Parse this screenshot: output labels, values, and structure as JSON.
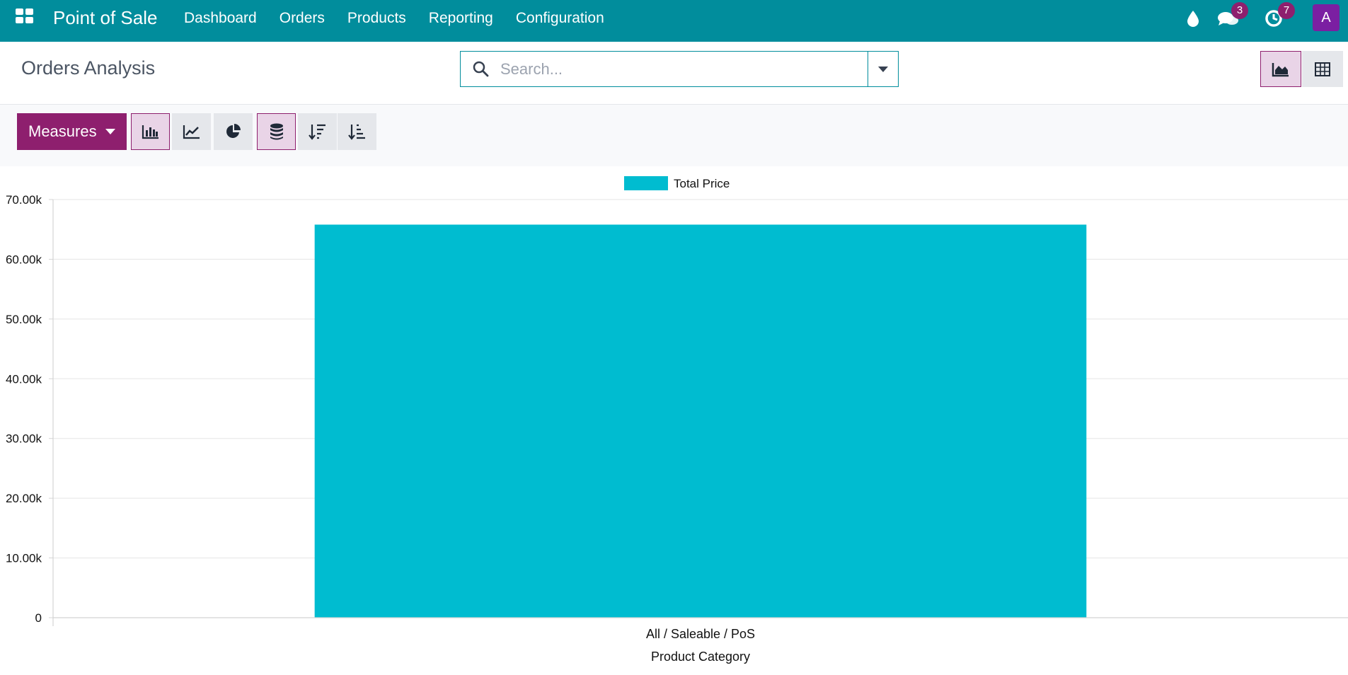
{
  "navbar": {
    "apps_icon": "grid-icon",
    "brand": "Point of Sale",
    "menu": [
      {
        "label": "Dashboard"
      },
      {
        "label": "Orders"
      },
      {
        "label": "Products"
      },
      {
        "label": "Reporting"
      },
      {
        "label": "Configuration"
      }
    ],
    "systray": {
      "debug_icon": "droplet-icon",
      "messages_icon": "chat-bubbles-icon",
      "messages_count": "3",
      "activities_icon": "clock-icon",
      "activities_count": "7",
      "avatar_letter": "A"
    },
    "color": "#018d9c"
  },
  "control_panel": {
    "title": "Orders Analysis",
    "search": {
      "placeholder": "Search...",
      "value": ""
    },
    "views": [
      {
        "name": "graph",
        "icon": "area-chart-icon",
        "active": true
      },
      {
        "name": "pivot",
        "icon": "table-icon",
        "active": false
      }
    ]
  },
  "toolbar": {
    "measures_label": "Measures",
    "accent": "#8e1f6e",
    "buttons": [
      {
        "name": "bar-chart-button",
        "icon": "bar-chart-icon",
        "active": true
      },
      {
        "name": "line-chart-button",
        "icon": "line-chart-icon",
        "active": false
      },
      {
        "name": "pie-chart-button",
        "icon": "pie-chart-icon",
        "active": false
      },
      {
        "name": "stacked-button",
        "icon": "database-stack-icon",
        "active": true
      },
      {
        "name": "sort-descending-button",
        "icon": "sort-descending-icon",
        "active": false
      },
      {
        "name": "sort-ascending-button",
        "icon": "sort-ascending-icon",
        "active": false
      }
    ]
  },
  "chart_data": {
    "type": "bar",
    "categories": [
      "All / Saleable / PoS"
    ],
    "series": [
      {
        "name": "Total Price",
        "values": [
          65800
        ],
        "color": "#00bcd0"
      }
    ],
    "xlabel": "Product Category",
    "ylabel": "",
    "ylim": [
      0,
      70000
    ],
    "yticks": [
      0,
      10000,
      20000,
      30000,
      40000,
      50000,
      60000,
      70000
    ],
    "ytick_labels": [
      "0",
      "10.00k",
      "20.00k",
      "30.00k",
      "40.00k",
      "50.00k",
      "60.00k",
      "70.00k"
    ],
    "grid": true,
    "legend": "top-center"
  }
}
